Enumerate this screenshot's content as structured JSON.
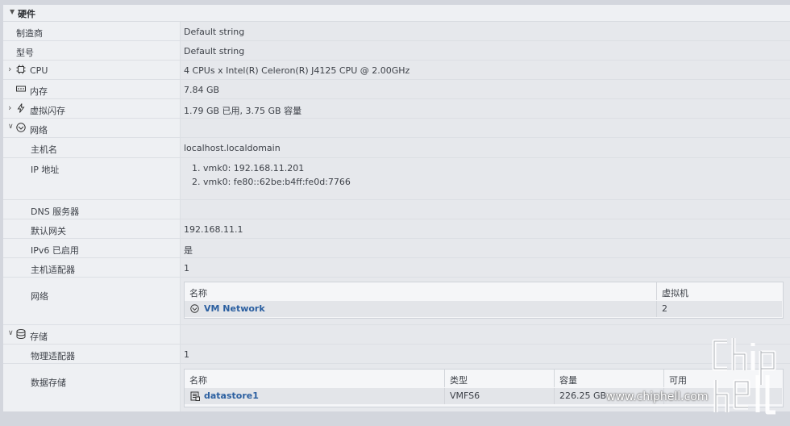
{
  "hardware": {
    "title": "硬件",
    "manufacturer": {
      "label": "制造商",
      "value": "Default string"
    },
    "model": {
      "label": "型号",
      "value": "Default string"
    },
    "cpu": {
      "label": "CPU",
      "value": "4 CPUs x Intel(R) Celeron(R) J4125 CPU @ 2.00GHz"
    },
    "memory": {
      "label": "内存",
      "value": "7.84 GB"
    },
    "vflash": {
      "label": "虚拟闪存",
      "value": "1.79 GB 已用, 3.75 GB 容量"
    },
    "network": {
      "label": "网络",
      "hostname": {
        "label": "主机名",
        "value": "localhost.localdomain"
      },
      "ip": {
        "label": "IP 地址",
        "values": [
          "1. vmk0: 192.168.11.201",
          "2. vmk0: fe80::62be:b4ff:fe0d:7766"
        ]
      },
      "dns": {
        "label": "DNS 服务器",
        "value": ""
      },
      "gateway": {
        "label": "默认网关",
        "value": "192.168.11.1"
      },
      "ipv6": {
        "label": "IPv6 已启用",
        "value": "是"
      },
      "adapters": {
        "label": "主机适配器",
        "value": "1"
      },
      "networks": {
        "label": "网络",
        "columns": [
          "名称",
          "虚拟机"
        ],
        "rows": [
          {
            "name": "VM Network",
            "vms": "2"
          }
        ]
      }
    },
    "storage": {
      "label": "存储",
      "physical_adapters": {
        "label": "物理适配器",
        "value": "1"
      },
      "datastores": {
        "label": "数据存储",
        "columns": [
          "名称",
          "类型",
          "容量",
          "可用"
        ],
        "rows": [
          {
            "name": "datastore1",
            "type": "VMFS6",
            "capacity": "226.25 GB",
            "free": ""
          }
        ]
      }
    }
  },
  "watermark": {
    "text": "www.chiphell.com"
  }
}
